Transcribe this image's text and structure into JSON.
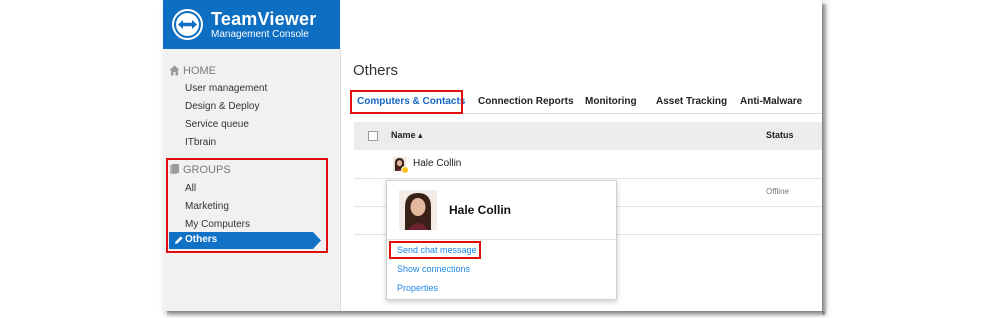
{
  "brand": {
    "name": "TeamViewer",
    "subtitle": "Management Console"
  },
  "sidebar": {
    "home_label": "HOME",
    "home_items": [
      "User management",
      "Design & Deploy",
      "Service queue",
      "ITbrain"
    ],
    "groups_label": "GROUPS",
    "group_items": [
      "All",
      "Marketing",
      "My Computers"
    ],
    "active_item": "Others"
  },
  "main": {
    "title": "Others",
    "tabs": [
      "Computers & Contacts",
      "Connection Reports",
      "Monitoring",
      "Asset Tracking",
      "Anti-Malware"
    ],
    "table": {
      "col_name": "Name ▴",
      "col_status": "Status",
      "rows": [
        {
          "name": "Hale Collin",
          "status": ""
        },
        {
          "name": "",
          "status": "Offline"
        }
      ]
    }
  },
  "popup": {
    "name": "Hale Collin",
    "links": [
      "Send chat message",
      "Show connections",
      "Properties"
    ]
  },
  "colors": {
    "brand_blue": "#0e6ec2",
    "active_nav": "#1071c5",
    "link": "#1e88e5",
    "highlight": "#e01010",
    "away_status": "#f7c21b"
  },
  "icons": {
    "logo": "teamviewer-logo-icon",
    "home": "home-icon",
    "groups": "groups-icon",
    "edit": "pencil-icon"
  }
}
